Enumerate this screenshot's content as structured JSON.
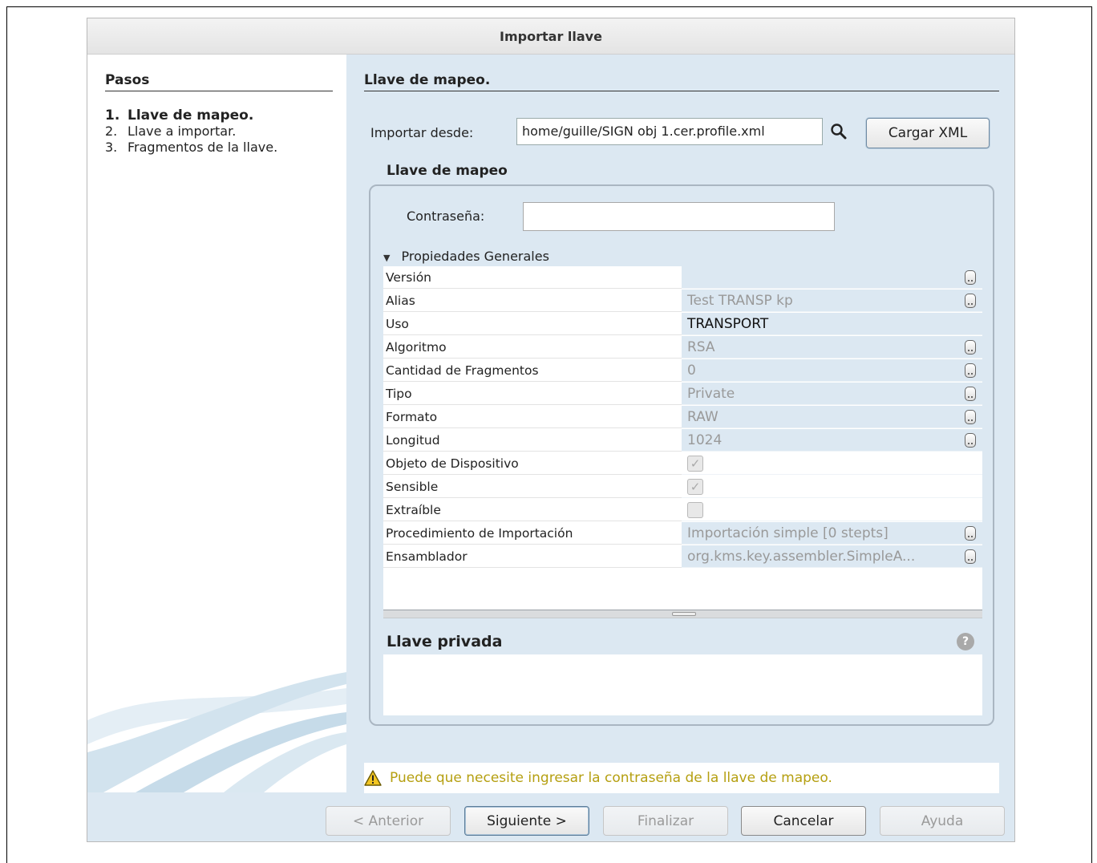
{
  "window": {
    "title": "Importar llave"
  },
  "steps": {
    "title": "Pasos",
    "items": [
      {
        "num": "1.",
        "label": "Llave de mapeo."
      },
      {
        "num": "2.",
        "label": "Llave a importar."
      },
      {
        "num": "3.",
        "label": "Fragmentos de la llave."
      }
    ]
  },
  "panel": {
    "title": "Llave de mapeo.",
    "import_label": "Importar desde:",
    "import_value": "home/guille/SIGN obj 1.cer.profile.xml",
    "load_button": "Cargar XML",
    "group_title": "Llave de mapeo",
    "password_label": "Contraseña:",
    "password_value": "",
    "props_title": "Propiedades Generales",
    "properties": [
      {
        "name": "Versión",
        "value": ""
      },
      {
        "name": "Alias",
        "value": "Test TRANSP kp"
      },
      {
        "name": "Uso",
        "value": "TRANSPORT"
      },
      {
        "name": "Algoritmo",
        "value": "RSA"
      },
      {
        "name": "Cantidad de Fragmentos",
        "value": "0"
      },
      {
        "name": "Tipo",
        "value": "Private"
      },
      {
        "name": "Formato",
        "value": "RAW"
      },
      {
        "name": "Longitud",
        "value": "1024"
      },
      {
        "name": "Objeto de Dispositivo",
        "checked": true
      },
      {
        "name": "Sensible",
        "checked": true
      },
      {
        "name": "Extraíble",
        "checked": false
      },
      {
        "name": "Procedimiento de Importación",
        "value": "Importación simple [0 stepts]"
      },
      {
        "name": "Ensamblador",
        "value": "org.kms.key.assembler.SimpleA..."
      }
    ],
    "private_key_title": "Llave privada",
    "warning": "Puede que necesite ingresar la contraseña de la llave de mapeo."
  },
  "buttons": {
    "prev": "< Anterior",
    "next": "Siguiente >",
    "finish": "Finalizar",
    "cancel": "Cancelar",
    "help": "Ayuda"
  }
}
